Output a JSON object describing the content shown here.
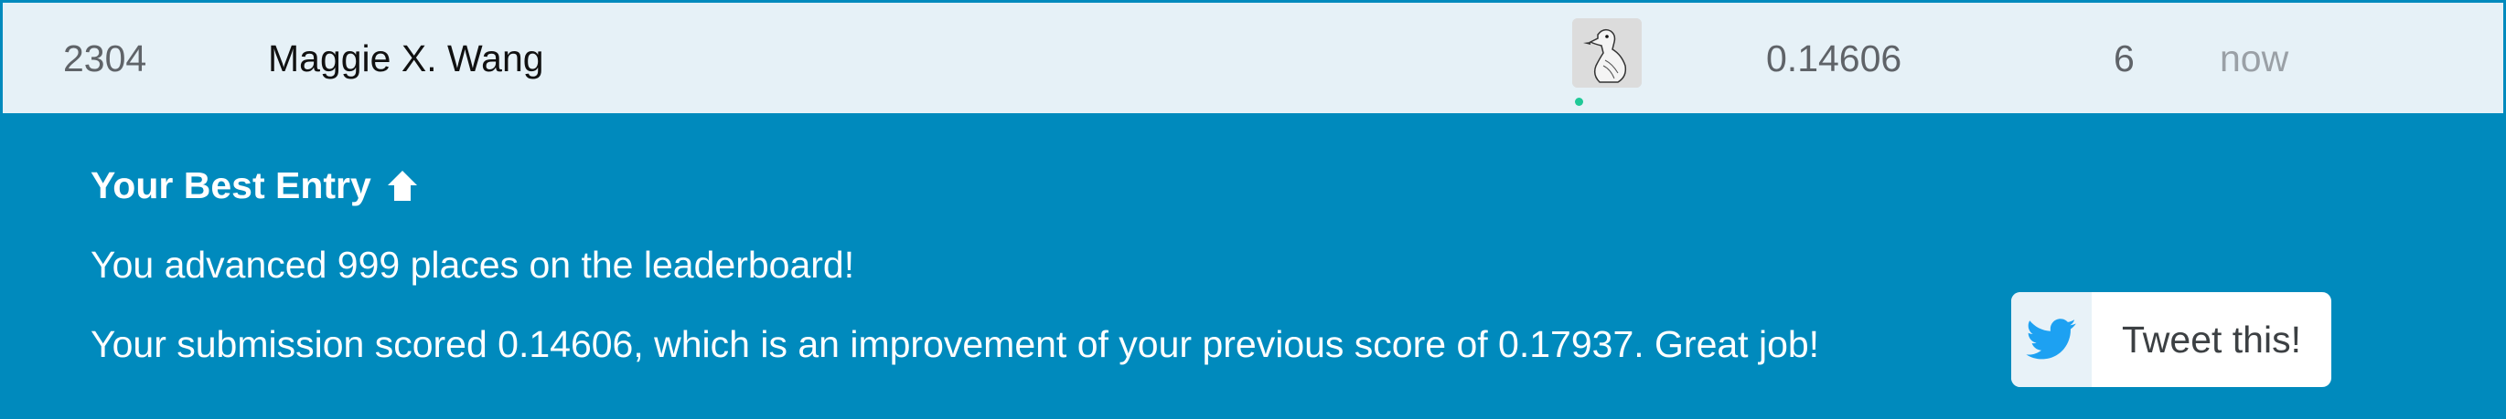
{
  "leaderboard_row": {
    "rank": "2304",
    "team_name": "Maggie X. Wang",
    "avatar_icon": "goose-avatar-icon",
    "online_status": "online",
    "score": "0.14606",
    "entries": "6",
    "last": "now"
  },
  "best_entry": {
    "title": "Your Best Entry",
    "title_icon": "arrow-up-icon",
    "advanced_message": "You advanced 999 places on the leaderboard!",
    "score_message": "Your submission scored 0.14606, which is an improvement of your previous score of 0.17937. Great job!",
    "tweet_button_label": "Tweet this!",
    "tweet_icon": "twitter-bird-icon"
  },
  "colors": {
    "panel_background": "#008abd",
    "row_background": "#e6f1f7",
    "online_dot": "#20c997",
    "twitter_blue": "#1da1f2"
  }
}
